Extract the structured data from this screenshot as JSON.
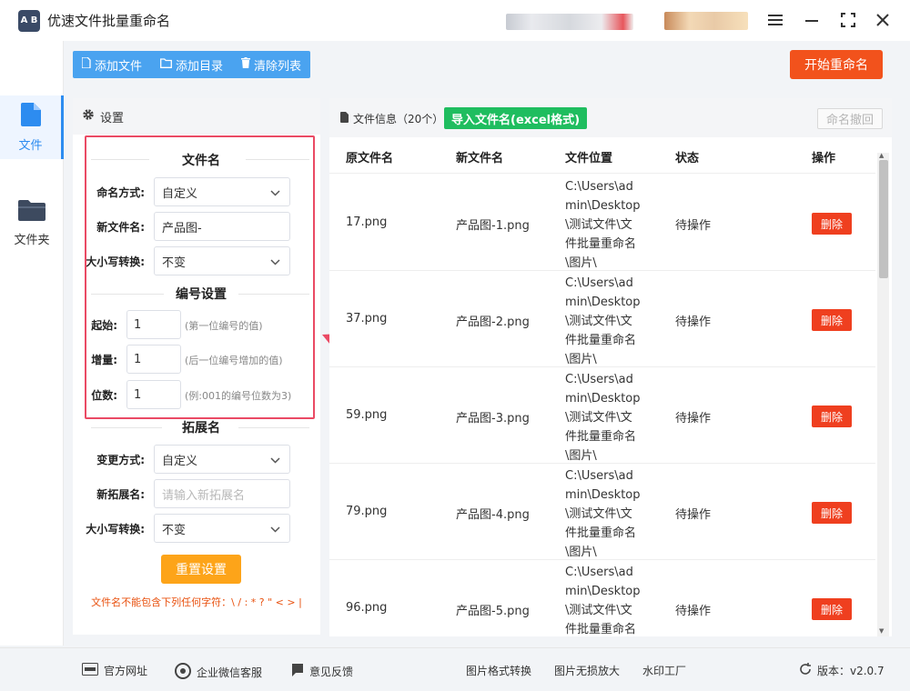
{
  "app": {
    "title": "优速文件批量重命名",
    "logo_text": "A B"
  },
  "window_controls": [
    "menu-icon",
    "minimize-icon",
    "maximize-icon",
    "close-icon"
  ],
  "nav": {
    "items": [
      {
        "label": "文件",
        "icon": "file-icon",
        "active": true
      },
      {
        "label": "文件夹",
        "icon": "folder-icon",
        "active": false
      }
    ]
  },
  "toolbar": {
    "add_file": "添加文件",
    "add_dir": "添加目录",
    "clear_list": "清除列表",
    "start": "开始重命名"
  },
  "settings": {
    "header": "设置",
    "filename_section": "文件名",
    "naming_mode_label": "命名方式:",
    "naming_mode_value": "自定义",
    "new_name_label": "新文件名:",
    "new_name_value": "产品图-",
    "case_label": "大小写转换:",
    "case_value": "不变",
    "numbering_section": "编号设置",
    "start_label": "起始:",
    "start_value": "1",
    "start_hint": "(第一位编号的值)",
    "increment_label": "增量:",
    "increment_value": "1",
    "increment_hint": "(后一位编号增加的值)",
    "digits_label": "位数:",
    "digits_value": "1",
    "digits_hint": "(例:001的编号位数为3)",
    "ext_section": "拓展名",
    "change_mode_label": "变更方式:",
    "change_mode_value": "自定义",
    "new_ext_label": "新拓展名:",
    "new_ext_placeholder": "请输入新拓展名",
    "ext_case_label": "大小写转换:",
    "ext_case_value": "不变",
    "reset": "重置设置",
    "warning": "文件名不能包含下列任何字符：\\ / : * ? \" < > |"
  },
  "files": {
    "title": "文件信息（20个）",
    "import_btn": "导入文件名(excel格式)",
    "undo_btn": "命名撤回",
    "columns": [
      "原文件名",
      "新文件名",
      "文件位置",
      "状态",
      "操作"
    ],
    "rows": [
      {
        "orig": "17.png",
        "new": "产品图-1.png",
        "loc": [
          "C:\\Users\\ad",
          "min\\Desktop",
          "\\测试文件\\文",
          "件批量重命名",
          "\\图片\\"
        ],
        "status": "待操作",
        "action": "删除"
      },
      {
        "orig": "37.png",
        "new": "产品图-2.png",
        "loc": [
          "C:\\Users\\ad",
          "min\\Desktop",
          "\\测试文件\\文",
          "件批量重命名",
          "\\图片\\"
        ],
        "status": "待操作",
        "action": "删除"
      },
      {
        "orig": "59.png",
        "new": "产品图-3.png",
        "loc": [
          "C:\\Users\\ad",
          "min\\Desktop",
          "\\测试文件\\文",
          "件批量重命名",
          "\\图片\\"
        ],
        "status": "待操作",
        "action": "删除"
      },
      {
        "orig": "79.png",
        "new": "产品图-4.png",
        "loc": [
          "C:\\Users\\ad",
          "min\\Desktop",
          "\\测试文件\\文",
          "件批量重命名",
          "\\图片\\"
        ],
        "status": "待操作",
        "action": "删除"
      },
      {
        "orig": "96.png",
        "new": "产品图-5.png",
        "loc": [
          "C:\\Users\\ad",
          "min\\Desktop",
          "\\测试文件\\文",
          "件批量重命名"
        ],
        "status": "待操作",
        "action": "删除"
      }
    ]
  },
  "footer": {
    "website": "官方网址",
    "wechat": "企业微信客服",
    "feedback": "意见反馈",
    "format_convert": "图片格式转换",
    "lossless": "图片无损放大",
    "watermark": "水印工厂",
    "version": "版本：v2.0.7"
  },
  "colors": {
    "primary": "#4aa3f0",
    "start": "#f2521c",
    "import": "#1fbd5f",
    "reset": "#fda419",
    "delete": "#ef3f1f",
    "annotation": "#ea4a64"
  }
}
